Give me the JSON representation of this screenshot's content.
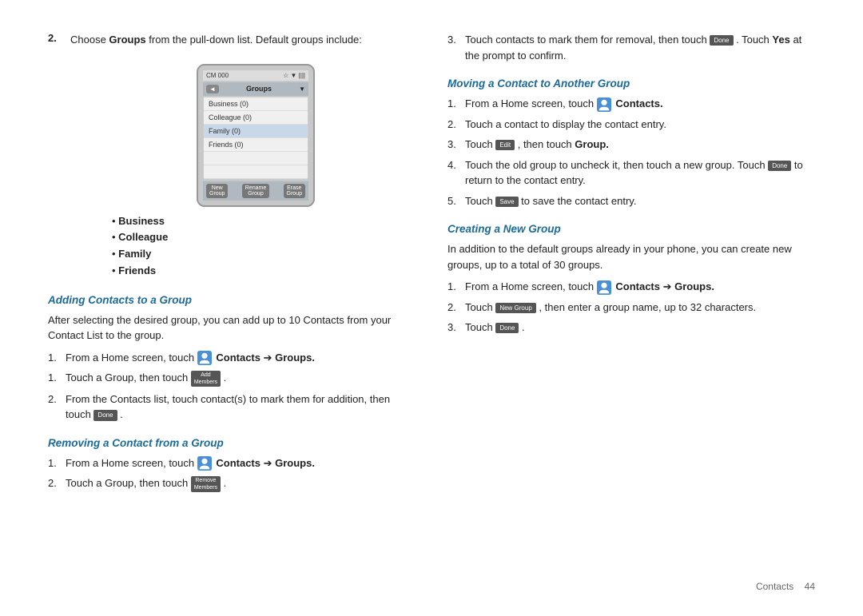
{
  "page": {
    "number": "44",
    "section_label": "Contacts"
  },
  "left": {
    "step2_number": "2.",
    "step2_text_1": "Choose ",
    "step2_bold": "Groups",
    "step2_text_2": " from the pull-down list. Default groups include:",
    "bullets": [
      {
        "bold": "Business"
      },
      {
        "bold": "Colleague"
      },
      {
        "bold": "Family"
      },
      {
        "bold": "Friends"
      }
    ],
    "phone": {
      "status_left": "CM 000",
      "status_right": "▼ ☆ ||||||",
      "back_label": "◄",
      "title": "Groups",
      "dropdown": "▼",
      "list_items": [
        "Business (0)",
        "Colleague (0)",
        "Family (0)",
        "Friends (0)"
      ],
      "bottom_buttons": [
        {
          "line1": "New",
          "line2": "Group"
        },
        {
          "line1": "Rename",
          "line2": "Group"
        },
        {
          "line1": "Erase",
          "line2": "Group"
        }
      ]
    },
    "adding_header": "Adding Contacts to a Group",
    "adding_intro": "After selecting the desired group, you can add up to 10 Contacts from your Contact List to the group.",
    "adding_steps": [
      {
        "num": "1.",
        "text_before_icon": "From a Home screen, touch",
        "icon": true,
        "bold": "Contacts",
        "arrow": "➔",
        "bold2": "Groups."
      },
      {
        "num": "1.",
        "text": "Touch a Group, then touch",
        "btn_line1": "Add",
        "btn_line2": "Members",
        "after": "."
      },
      {
        "num": "2.",
        "text": "From the Contacts list, touch contact(s) to mark them for addition, then touch",
        "btn": "Done",
        "after": "."
      }
    ],
    "removing_header": "Removing a Contact from a Group",
    "removing_steps": [
      {
        "num": "1.",
        "text_before_icon": "From a Home screen, touch",
        "icon": true,
        "bold": "Contacts",
        "arrow": "➔",
        "bold2": "Groups."
      },
      {
        "num": "2.",
        "text": "Touch a Group, then touch",
        "btn_line1": "Remove",
        "btn_line2": "Members",
        "after": "."
      }
    ]
  },
  "right": {
    "step3_number": "3.",
    "step3_text": "Touch contacts to mark them for removal, then touch",
    "step3_btn": "Done",
    "step3_text2": ". Touch ",
    "step3_bold": "Yes",
    "step3_text3": " at the prompt to confirm.",
    "moving_header": "Moving a Contact to Another Group",
    "moving_steps": [
      {
        "num": "1.",
        "text_before_icon": "From a Home screen, touch",
        "icon": true,
        "bold": "Contacts."
      },
      {
        "num": "2.",
        "text": "Touch a contact to display the contact entry."
      },
      {
        "num": "3.",
        "text": "Touch",
        "btn": "Edit",
        "text2": ", then touch ",
        "bold": "Group."
      },
      {
        "num": "4.",
        "text": "Touch the old group to uncheck it, then touch a new group. Touch",
        "btn": "Done",
        "text2": "to return to the contact entry."
      },
      {
        "num": "5.",
        "text": "Touch",
        "btn": "Save",
        "text2": "to save the contact entry."
      }
    ],
    "creating_header": "Creating a New Group",
    "creating_intro": "In addition to the default groups already in your phone, you can create new groups, up to a total of 30 groups.",
    "creating_steps": [
      {
        "num": "1.",
        "text_before_icon": "From a Home screen, touch",
        "icon": true,
        "bold": "Contacts",
        "arrow": "➔",
        "bold2": "Groups."
      },
      {
        "num": "2.",
        "text": "Touch",
        "btn": "New Group",
        "text2": ", then enter a group name, up to 32 characters."
      },
      {
        "num": "3.",
        "text": "Touch",
        "btn": "Done",
        "after": "."
      }
    ]
  }
}
